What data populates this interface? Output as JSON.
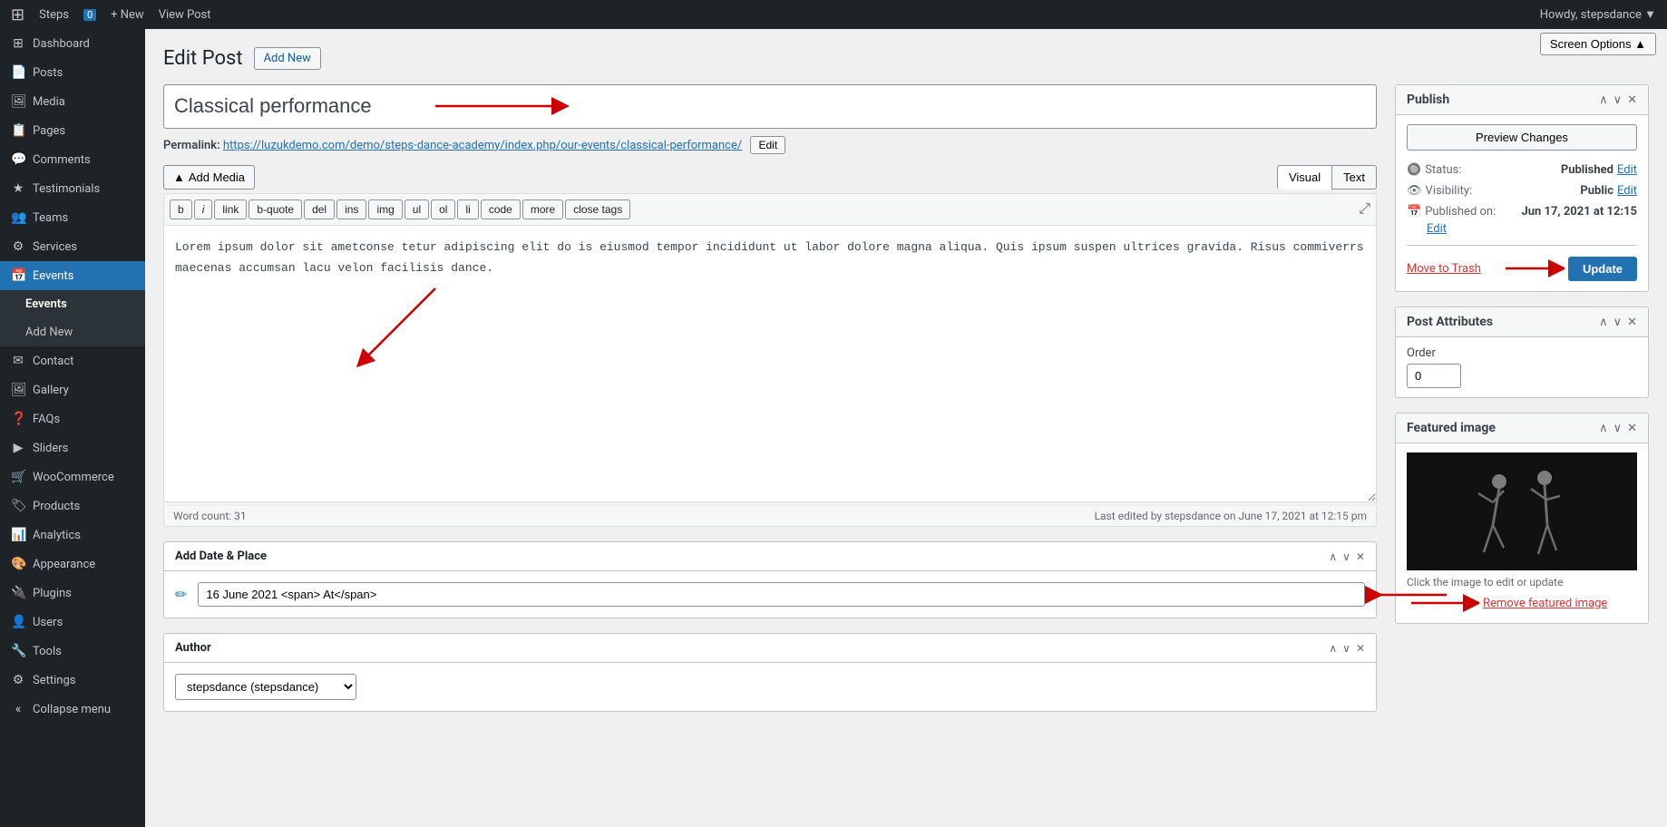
{
  "adminBar": {
    "wpLogo": "⊞",
    "siteName": "Steps",
    "commentCount": "0",
    "newLabel": "+ New",
    "viewPost": "View Post",
    "userGreeting": "Howdy, stepsdance ▼"
  },
  "screenOptions": {
    "label": "Screen Options ▲"
  },
  "sidebar": {
    "items": [
      {
        "id": "dashboard",
        "icon": "⊞",
        "label": "Dashboard"
      },
      {
        "id": "posts",
        "icon": "📄",
        "label": "Posts"
      },
      {
        "id": "media",
        "icon": "🖼",
        "label": "Media"
      },
      {
        "id": "pages",
        "icon": "📋",
        "label": "Pages"
      },
      {
        "id": "comments",
        "icon": "💬",
        "label": "Comments"
      },
      {
        "id": "testimonials",
        "icon": "⭐",
        "label": "Testimonials"
      },
      {
        "id": "teams",
        "icon": "👥",
        "label": "Teams"
      },
      {
        "id": "services",
        "icon": "⚙",
        "label": "Services"
      },
      {
        "id": "eevents",
        "icon": "📅",
        "label": "Eevents",
        "active": true,
        "arrow": "◀"
      },
      {
        "id": "contact",
        "icon": "✉",
        "label": "Contact"
      },
      {
        "id": "gallery",
        "icon": "🖼",
        "label": "Gallery"
      },
      {
        "id": "faqs",
        "icon": "❓",
        "label": "FAQs"
      },
      {
        "id": "sliders",
        "icon": "▶",
        "label": "Sliders"
      },
      {
        "id": "woocommerce",
        "icon": "🛒",
        "label": "WooCommerce"
      },
      {
        "id": "products",
        "icon": "🏷",
        "label": "Products"
      },
      {
        "id": "analytics",
        "icon": "📊",
        "label": "Analytics"
      },
      {
        "id": "appearance",
        "icon": "🎨",
        "label": "Appearance"
      },
      {
        "id": "plugins",
        "icon": "🔌",
        "label": "Plugins"
      },
      {
        "id": "users",
        "icon": "👤",
        "label": "Users"
      },
      {
        "id": "tools",
        "icon": "🔧",
        "label": "Tools"
      },
      {
        "id": "settings",
        "icon": "⚙",
        "label": "Settings"
      },
      {
        "id": "collapse",
        "icon": "«",
        "label": "Collapse menu"
      }
    ],
    "submenu": {
      "sectionLabel": "Eevents",
      "items": [
        {
          "id": "eevents-list",
          "label": "Eevents"
        },
        {
          "id": "eevents-add",
          "label": "Add New"
        }
      ]
    }
  },
  "page": {
    "title": "Edit Post",
    "addNewLabel": "Add New"
  },
  "post": {
    "title": "Classical performance",
    "permalink": {
      "label": "Permalink:",
      "url": "https://luzukdemo.com/demo/steps-dance-academy/index.php/our-events/classical-performance/",
      "editLabel": "Edit"
    },
    "editor": {
      "addMediaLabel": "Add Media",
      "visualTab": "Visual",
      "textTab": "Text",
      "formatButtons": [
        "b",
        "i",
        "link",
        "b-quote",
        "del",
        "ins",
        "img",
        "ul",
        "ol",
        "li",
        "code",
        "more",
        "close tags"
      ],
      "content": "Lorem ipsum dolor sit ametconse tetur adipiscing elit do is eiusmod tempor incididunt ut labor dolore magna aliqua. Quis ipsum suspen ultrices gravida. Risus commiverrs maecenas accumsan lacu velon facilisis dance.",
      "wordCount": "Word count: 31",
      "lastEdited": "Last edited by stepsdance on June 17, 2021 at 12:15 pm"
    }
  },
  "addDatePlace": {
    "title": "Add Date & Place",
    "dateValue": "16 June 2021 <span> At</span>"
  },
  "author": {
    "title": "Author",
    "selected": "stepsdance (stepsdance)",
    "options": [
      "stepsdance (stepsdance)"
    ]
  },
  "publish": {
    "title": "Publish",
    "previewChangesLabel": "Preview Changes",
    "status": {
      "label": "Status:",
      "value": "Published",
      "editLabel": "Edit"
    },
    "visibility": {
      "label": "Visibility:",
      "value": "Public",
      "editLabel": "Edit"
    },
    "publishedOn": {
      "label": "Published on:",
      "value": "Jun 17, 2021 at 12:15",
      "editLabel": "Edit"
    },
    "moveToTrash": "Move to Trash",
    "updateLabel": "Update"
  },
  "postAttributes": {
    "title": "Post Attributes",
    "orderLabel": "Order",
    "orderValue": "0"
  },
  "featuredImage": {
    "title": "Featured image",
    "hint": "Click the image to edit or update",
    "removeLabel": "Remove featured image"
  },
  "arrows": {
    "titleArrow": "→",
    "contentArrow": "↖",
    "dateArrow": "←",
    "updateArrow": "→",
    "removeArrow": "→"
  }
}
